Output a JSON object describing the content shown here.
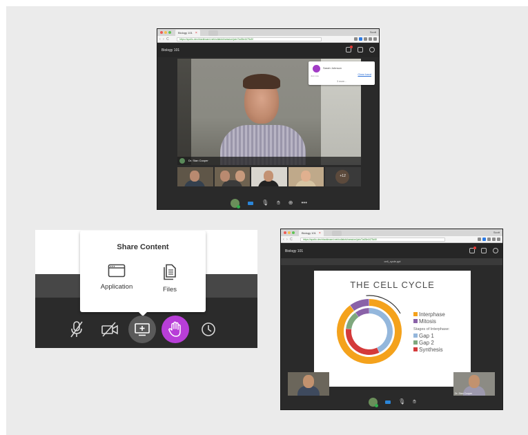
{
  "browser": {
    "tab_title": "Biology 101",
    "url": "https://apollo-dev.blackboard.net/collab/ui/session/join/7a45e4475c5f",
    "window_user": "Scott"
  },
  "window_main": {
    "course_title": "Biology 101",
    "speaker_name": "Dr. Stan Cooper",
    "notification": {
      "name": "Sarah Johnson",
      "status": "Just now",
      "action": "Clear hand",
      "more": "3 more..."
    },
    "overflow_count": "+12"
  },
  "share_panel": {
    "title": "Share Content",
    "options": [
      {
        "label": "Application",
        "icon": "application-window-icon"
      },
      {
        "label": "Files",
        "icon": "files-icon"
      }
    ],
    "controls": [
      "microphone-muted-icon",
      "camera-muted-icon",
      "share-content-icon",
      "raise-hand-icon",
      "clock-icon"
    ],
    "colors": {
      "hand_button": "#b83ed8"
    }
  },
  "window_slide": {
    "course_title": "Biology 101",
    "file_name": "cell_cycle.ppt",
    "slide_title": "THE CELL CYCLE",
    "legend": {
      "main": [
        {
          "label": "Interphase",
          "color": "#f4a21c"
        },
        {
          "label": "Mitosis",
          "color": "#8a62a8"
        }
      ],
      "subtitle": "Stages of Interphase:",
      "stages": [
        {
          "label": "Gap 1",
          "color": "#94b7dc"
        },
        {
          "label": "Gap 2",
          "color": "#7fa87e"
        },
        {
          "label": "Synthesis",
          "color": "#d43a3a"
        }
      ]
    },
    "presenter_name": "Dr. Stan Cooper"
  },
  "chart_data": {
    "type": "pie",
    "title": "THE CELL CYCLE",
    "rings": [
      {
        "name": "outer",
        "labels": [
          "Interphase",
          "Mitosis"
        ],
        "values": [
          90,
          10
        ],
        "colors": [
          "#f4a21c",
          "#8a62a8"
        ]
      },
      {
        "name": "inner",
        "labels": [
          "Gap 1",
          "Synthesis",
          "Gap 2",
          "Mitosis"
        ],
        "values": [
          43,
          34,
          13,
          10
        ],
        "colors": [
          "#94b7dc",
          "#d43a3a",
          "#7fa87e",
          "#8a62a8"
        ]
      }
    ],
    "legend_placement": "right"
  }
}
